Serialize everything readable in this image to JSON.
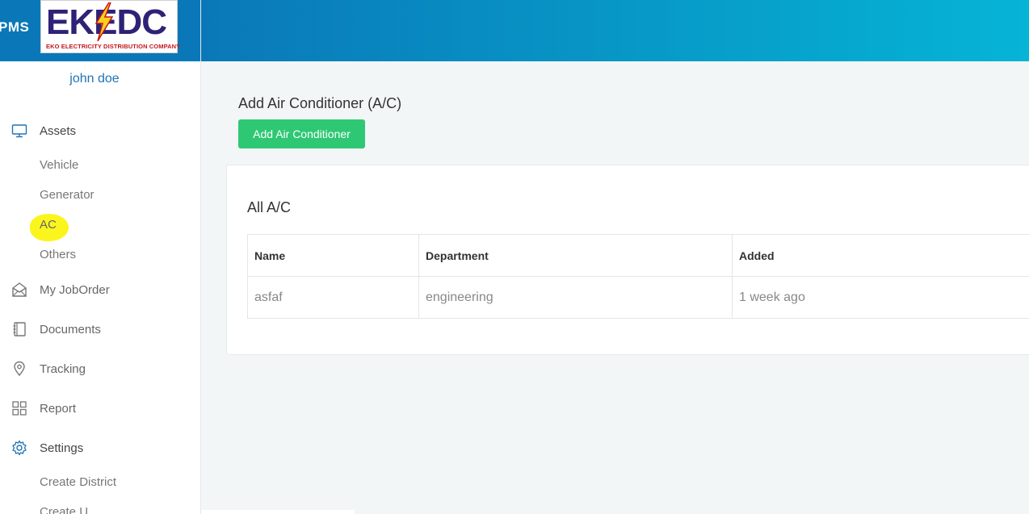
{
  "brand": {
    "app_abbrev": "PMS",
    "logo_text": "EKEDC",
    "logo_subtitle": "EKO ELECTRICITY DISTRIBUTION COMPANY"
  },
  "user": {
    "name": "john doe"
  },
  "sidebar": {
    "assets": {
      "label": "Assets",
      "icon": "monitor-icon",
      "items": [
        "Vehicle",
        "Generator",
        "AC",
        "Others"
      ]
    },
    "job_order": {
      "label": "My JobOrder",
      "icon": "envelope-open-icon"
    },
    "documents": {
      "label": "Documents",
      "icon": "notebook-icon"
    },
    "tracking": {
      "label": "Tracking",
      "icon": "location-pin-icon"
    },
    "report": {
      "label": "Report",
      "icon": "grid-icon"
    },
    "settings": {
      "label": "Settings",
      "icon": "gear-icon",
      "items": [
        "Create District",
        "Create U"
      ]
    }
  },
  "main": {
    "title": "Add Air Conditioner (A/C)",
    "add_button": "Add Air Conditioner",
    "card_title": "All A/C",
    "table": {
      "columns": [
        "Name",
        "Department",
        "Added"
      ],
      "rows": [
        [
          "asfaf",
          "engineering",
          "1 week ago"
        ]
      ]
    }
  },
  "colors": {
    "accent": "#0a78b8",
    "button": "#2ec874",
    "highlight": "#fbf51e",
    "link": "#1e73b8"
  }
}
